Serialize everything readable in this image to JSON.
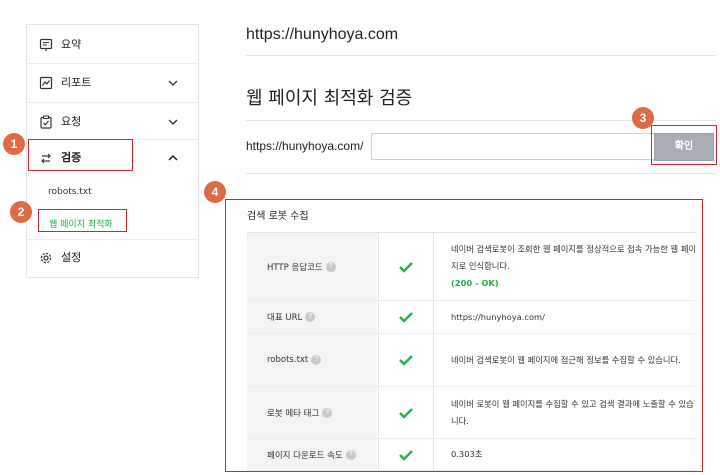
{
  "sidebar": {
    "items": [
      {
        "label": "요약",
        "icon": "summary-icon"
      },
      {
        "label": "리포트",
        "icon": "report-icon"
      },
      {
        "label": "요청",
        "icon": "request-icon"
      },
      {
        "label": "검증",
        "icon": "verify-icon"
      },
      {
        "label": "설정",
        "icon": "gear-icon"
      }
    ],
    "sub_items": [
      "robots.txt",
      "웹 페이지 최적화"
    ]
  },
  "callouts": [
    "1",
    "2",
    "3",
    "4"
  ],
  "header": {
    "site_url": "https://hunyhoya.com"
  },
  "main": {
    "page_title": "웹 페이지 최적화 검증",
    "url_prefix": "https://hunyhoya.com/",
    "url_input_value": "",
    "confirm_label": "확인",
    "section_title": "검색 로봇 수집",
    "rows": [
      {
        "label": "HTTP 응답코드",
        "desc": "네이버 검색로봇이 조회한 웹 페이지를 정상적으로 접속 가능한 웹 페이지로 인식합니다.",
        "status": "(200 - OK)"
      },
      {
        "label": "대표 URL",
        "desc": "https://hunyhoya.com/"
      },
      {
        "label": "robots.txt",
        "desc": "네이버 검색로봇이 웹 페이지에 접근해 정보를 수집할 수 있습니다."
      },
      {
        "label": "로봇 메타 태그",
        "desc": "네이버 로봇이 웹 페이지를 수집할 수 있고 검색 결과에 노출할 수 있습니다."
      },
      {
        "label": "페이지 다운로드 속도",
        "desc": "0.303초"
      }
    ]
  },
  "colors": {
    "accent_green": "#1fb34a",
    "callout_orange": "#de6b46",
    "highlight_red": "#d9232a",
    "button_gray": "#a9adb3"
  }
}
